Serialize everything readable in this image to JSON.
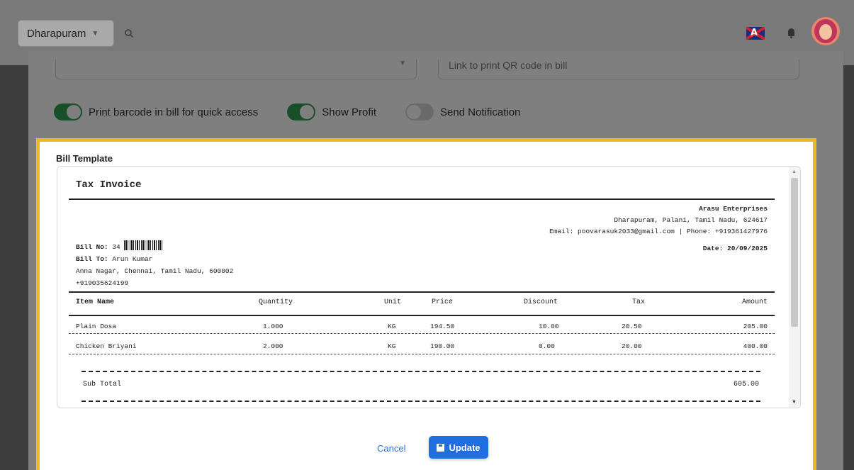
{
  "header": {
    "branch": "Dharapuram",
    "language_flag": "uk-flag-icon",
    "notifications_icon": "bell-icon"
  },
  "settings": {
    "left_input_value": "",
    "right_input_placeholder": "Link to print QR code in bill",
    "toggles": [
      {
        "label": "Print barcode in bill for quick access",
        "on": true
      },
      {
        "label": "Show Profit",
        "on": true
      },
      {
        "label": "Send Notification",
        "on": false
      }
    ]
  },
  "modal": {
    "section_label": "Bill Template",
    "cancel_label": "Cancel",
    "update_label": "Update",
    "accent_color": "#f5b327",
    "primary_color": "#1f6fe0"
  },
  "invoice": {
    "title": "Tax Invoice",
    "company": {
      "name": "Arasu Enterprises",
      "address": "Dharapuram, Palani, Tamil Nadu, 624617",
      "contact": "Email: poovarasuk2033@gmail.com | Phone: +919361427976",
      "date": "Date: 20/09/2025"
    },
    "bill": {
      "bill_no_label": "Bill No:",
      "bill_no": "34",
      "bill_to_label": "Bill To:",
      "bill_to": "Arun Kumar",
      "address": "Anna Nagar, Chennai, Tamil Nadu, 600002",
      "phone": "+919035624199"
    },
    "columns": [
      "Item Name",
      "Quantity",
      "Unit",
      "Price",
      "Discount",
      "Tax",
      "Amount"
    ],
    "rows": [
      {
        "item": "Plain Dosa",
        "qty": "1.000",
        "unit": "KG",
        "price": "194.50",
        "discount": "10.00",
        "tax": "20.50",
        "amount": "205.00"
      },
      {
        "item": "Chicken Briyani",
        "qty": "2.000",
        "unit": "KG",
        "price": "190.00",
        "discount": "0.00",
        "tax": "20.00",
        "amount": "400.00"
      }
    ],
    "subtotal_label": "Sub Total",
    "subtotal": "605.00"
  }
}
